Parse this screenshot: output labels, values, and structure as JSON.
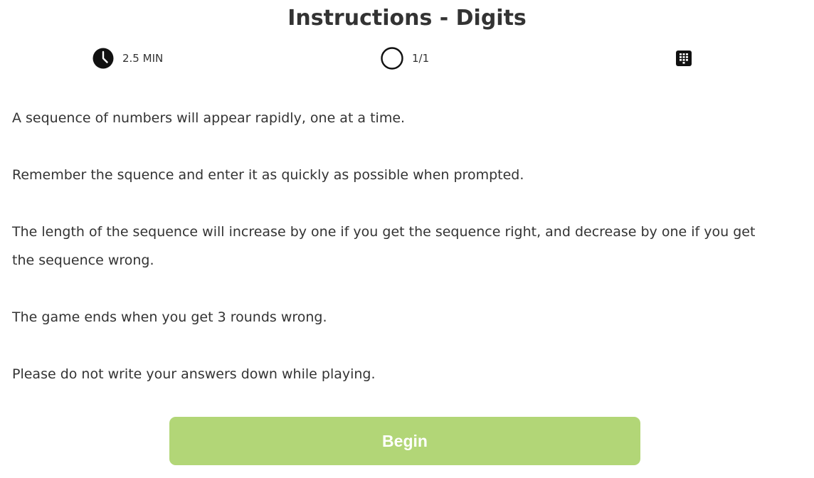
{
  "page": {
    "title": "Instructions - Digits"
  },
  "stats": {
    "time": {
      "icon": "clock-icon",
      "label": "2.5 MIN"
    },
    "rounds": {
      "icon": "circle-icon",
      "label": "1/1"
    },
    "mode": {
      "icon": "keypad-icon"
    }
  },
  "instructions": [
    "A sequence of numbers will appear rapidly, one at a time.",
    "Remember the squence and enter it as quickly as possible when prompted.",
    "The length of the sequence will increase by one if you get the sequence right, and decrease by one if you get the sequence wrong.",
    "The game ends when you get 3 rounds wrong.",
    "Please do not write your answers down while playing."
  ],
  "actions": {
    "begin_label": "Begin"
  },
  "colors": {
    "begin_button": "#b2d677",
    "text": "#333333"
  }
}
